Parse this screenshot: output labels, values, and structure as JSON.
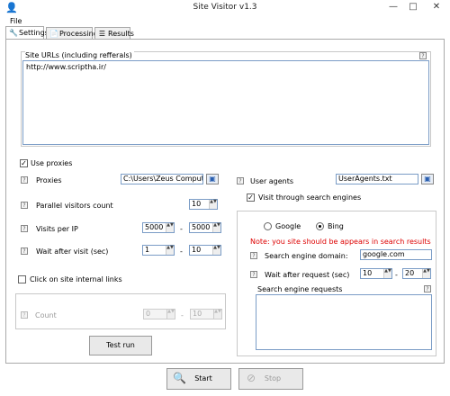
{
  "window": {
    "title": "Site Visitor v1.3",
    "minimize_glyph": "—",
    "maximize_glyph": "□",
    "close_glyph": "✕",
    "icon": "app-icon"
  },
  "menu": {
    "file": "File"
  },
  "tabs": [
    {
      "label": "Settings",
      "icon": "wrench-icon",
      "active": true
    },
    {
      "label": "Processing",
      "icon": "document-icon",
      "active": false
    },
    {
      "label": "Results",
      "icon": "list-icon",
      "active": false
    }
  ],
  "settings": {
    "help_glyph": "?",
    "site_urls": {
      "label": "Site URLs (including refferals)",
      "value": "http://www.scriptha.ir/"
    },
    "use_proxies": {
      "label": "Use proxies",
      "checked": true,
      "check_glyph": "✓"
    },
    "proxies": {
      "label": "Proxies",
      "value": "C:\\Users\\Zeus Computer\\De"
    },
    "user_agents": {
      "label": "User agents",
      "value": "UserAgents.txt"
    },
    "browse_glyph": "▣",
    "parallel_visitors": {
      "label": "Parallel visitors count",
      "value": "10"
    },
    "visits_per_ip": {
      "label": "Visits per IP",
      "from": "5000",
      "separator": "-",
      "to": "5000"
    },
    "wait_after_visit": {
      "label": "Wait after visit (sec)",
      "from": "1",
      "separator": "-",
      "to": "10"
    },
    "click_internal_links": {
      "label": "Click on site internal links",
      "checked": false
    },
    "count": {
      "label": "Count",
      "from": "0",
      "separator": "-",
      "to": "10",
      "enabled": false
    },
    "test_run": "Test run",
    "visit_through_search": {
      "label": "Visit through search engines",
      "checked": true,
      "check_glyph": "✓"
    },
    "search_engine": {
      "options": [
        {
          "label": "Google",
          "selected": false
        },
        {
          "label": "Bing",
          "selected": true
        }
      ],
      "note": "Note: you site should be appears in search results",
      "domain_label": "Search engine domain:",
      "domain_value": "google.com",
      "wait_label": "Wait after request (sec)",
      "wait_from": "10",
      "wait_separator": "-",
      "wait_to": "20",
      "requests_label": "Search engine requests"
    },
    "spin_glyph": "▲▼"
  },
  "footer": {
    "start": "Start",
    "stop": "Stop",
    "start_icon": "start-icon",
    "stop_icon": "stop-icon"
  },
  "colors": {
    "note": "#dd0000",
    "accent": "#7a9cc6"
  }
}
